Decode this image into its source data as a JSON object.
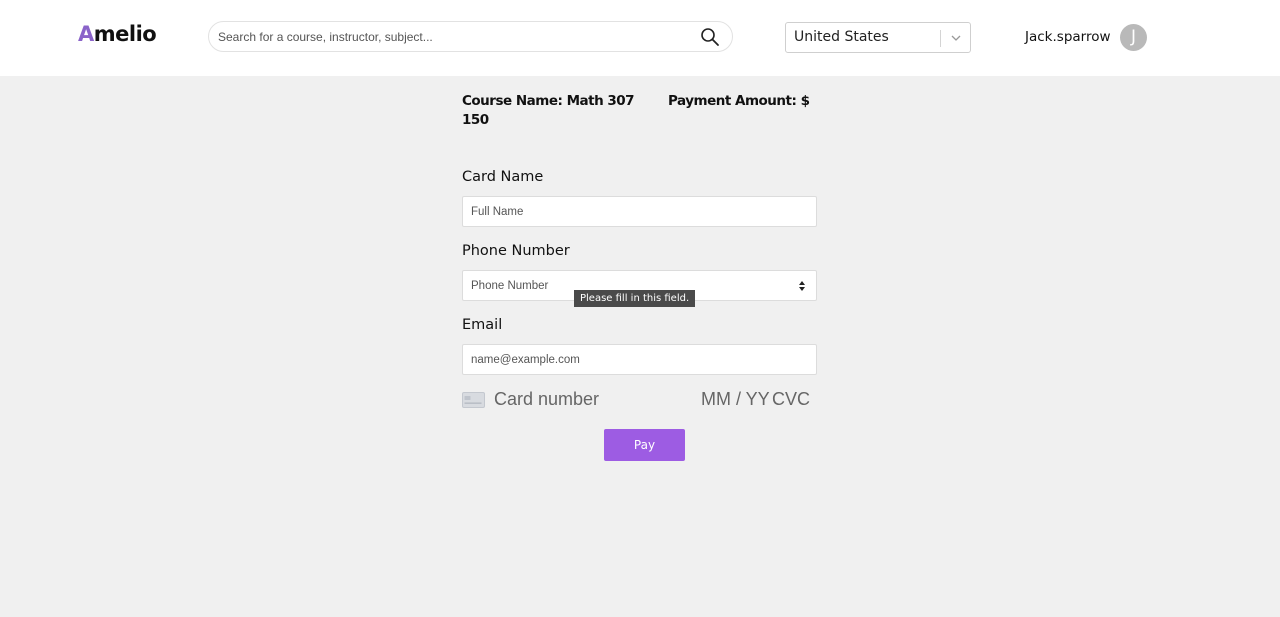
{
  "header": {
    "logo": {
      "first": "A",
      "rest": "melio"
    },
    "search": {
      "placeholder": "Search for a course, instructor, subject...",
      "value": "",
      "icon": "search-icon"
    },
    "country": {
      "value": "United States",
      "icon": "chevron-down-icon"
    },
    "user": {
      "name": "Jack.sparrow",
      "avatar_initial": "J"
    }
  },
  "summary": {
    "course": "Course Name: Math 307 150",
    "amount": "Payment Amount: $"
  },
  "form": {
    "card_name": {
      "label": "Card Name",
      "placeholder": "Full Name",
      "value": ""
    },
    "phone": {
      "label": "Phone Number",
      "placeholder": "Phone Number",
      "value": ""
    },
    "validation_tooltip": "Please fill in this field.",
    "email": {
      "label": "Email",
      "placeholder": "name@example.com",
      "value": ""
    },
    "card": {
      "number_placeholder": "Card number",
      "expiry_placeholder": "MM / YY",
      "cvc_placeholder": "CVC",
      "icon": "credit-card-icon"
    },
    "pay_label": "Pay"
  },
  "colors": {
    "accent": "#9d5ce3",
    "logo_accent": "#8a63c9",
    "page_background": "#f0f0f0",
    "header_background": "#ffffff"
  }
}
